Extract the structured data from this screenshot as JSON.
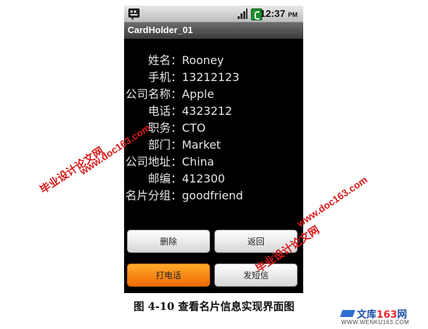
{
  "status_bar": {
    "time": "12:37",
    "ampm": "PM",
    "icons": [
      "message-icon",
      "signal-icon",
      "battery-icon"
    ]
  },
  "app": {
    "title": "CardHolder_01"
  },
  "card_fields": [
    {
      "label": "姓名：",
      "value": "Rooney"
    },
    {
      "label": "手机：",
      "value": "13212123"
    },
    {
      "label": "公司名称：",
      "value": "Apple"
    },
    {
      "label": "电话：",
      "value": "4323212"
    },
    {
      "label": "职务：",
      "value": "CTO"
    },
    {
      "label": "部门：",
      "value": "Market"
    },
    {
      "label": "公司地址：",
      "value": "China"
    },
    {
      "label": "邮编：",
      "value": "412300"
    },
    {
      "label": "名片分组：",
      "value": "goodfriend"
    }
  ],
  "buttons": {
    "delete": "删除",
    "back": "返回",
    "call": "打电话",
    "sms": "发短信"
  },
  "caption": "图 4-10 查看名片信息实现界面图",
  "watermarks": {
    "site_cn": "毕业设计论文网",
    "site_url": "www.doc163.com"
  },
  "logo": {
    "name_prefix": "文库",
    "name_number": "163",
    "name_suffix": "网",
    "url": "WWW.WENKU163.COM"
  },
  "colors": {
    "screen_bg": "#000000",
    "accent_orange": "#f06a05",
    "watermark_red": "#d81a1a"
  }
}
